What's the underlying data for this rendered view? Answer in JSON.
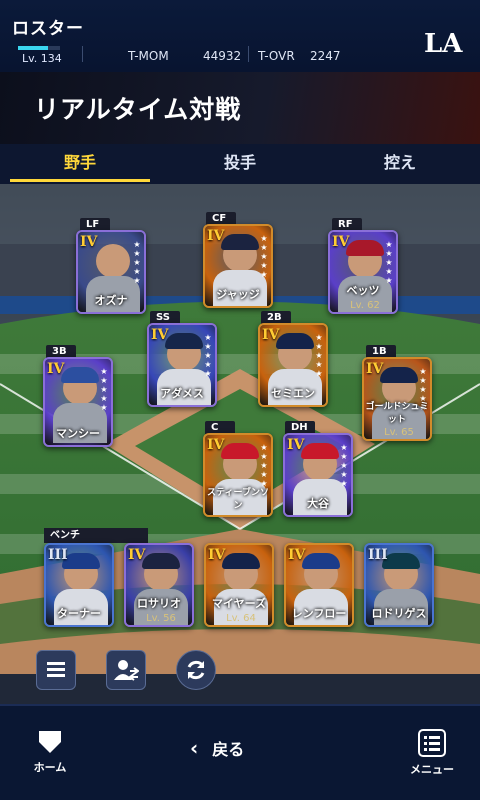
{
  "header": {
    "title": "ロスター",
    "level": "Lv. 134",
    "tmom_label": "T-MOM",
    "tmom_value": "44932",
    "tovr_label": "T-OVR",
    "tovr_value": "2247",
    "team_logo": "LA"
  },
  "mode_title": "リアルタイム対戦",
  "tabs": [
    {
      "label": "野手",
      "active": true
    },
    {
      "label": "投手",
      "active": false
    },
    {
      "label": "控え",
      "active": false
    }
  ],
  "lineup": [
    {
      "pos": "LF",
      "grade": "IV",
      "name": "オズナ",
      "level": "",
      "theme": "#3a4a8a"
    },
    {
      "pos": "CF",
      "grade": "IV",
      "name": "ジャッジ",
      "level": "",
      "theme": "#c8620e"
    },
    {
      "pos": "RF",
      "grade": "IV",
      "name": "ベッツ",
      "level": "Lv. 62",
      "theme": "#5a3fc8"
    },
    {
      "pos": "SS",
      "grade": "IV",
      "name": "アダメス",
      "level": "",
      "theme": "#3747b8"
    },
    {
      "pos": "2B",
      "grade": "IV",
      "name": "セミエン",
      "level": "",
      "theme": "#c8620e"
    },
    {
      "pos": "3B",
      "grade": "IV",
      "name": "マンシー",
      "level": "",
      "theme": "#5a3fc8"
    },
    {
      "pos": "1B",
      "grade": "IV",
      "name": "ゴールドシュミット",
      "level": "Lv. 65",
      "theme": "#b8551a"
    },
    {
      "pos": "C",
      "grade": "IV",
      "name": "スティーブンソン",
      "level": "",
      "theme": "#c8620e"
    },
    {
      "pos": "DH",
      "grade": "IV",
      "name": "大谷",
      "level": "",
      "theme": "#5a3fc8"
    }
  ],
  "bench_label": "ベンチ",
  "bench": [
    {
      "grade": "III",
      "name": "ターナー",
      "level": "",
      "theme": "#2e56b0"
    },
    {
      "grade": "IV",
      "name": "ロサリオ",
      "level": "Lv. 56",
      "theme": "#3a3fa8"
    },
    {
      "grade": "IV",
      "name": "マイヤーズ",
      "level": "Lv. 64",
      "theme": "#c8620e"
    },
    {
      "grade": "IV",
      "name": "レンフロー",
      "level": "",
      "theme": "#c8620e"
    },
    {
      "grade": "III",
      "name": "ロドリゲス",
      "level": "",
      "theme": "#2e56b0"
    }
  ],
  "bottom": {
    "home_label": "ホーム",
    "back_label": "戻る",
    "menu_label": "メニュー"
  },
  "colors": {
    "accent": "#ffd83a",
    "nav_bg": "#0a1733"
  }
}
